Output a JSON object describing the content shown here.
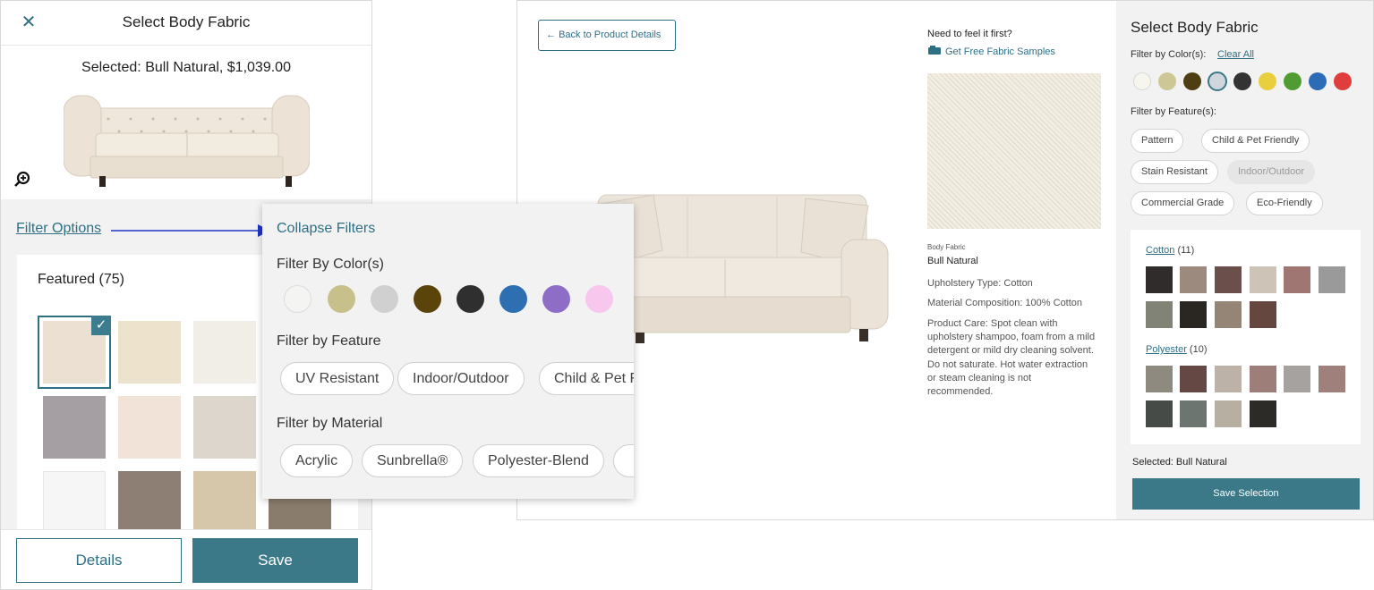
{
  "mobile": {
    "title": "Select Body Fabric",
    "selected_text": "Selected: Bull Natural, $1,039.00",
    "filter_options_link": "Filter Options",
    "featured_heading": "Featured (75)",
    "details_button": "Details",
    "save_button": "Save",
    "swatch_colors": [
      "#ece0d3",
      "#ede2cc",
      "#f1eee8",
      "#a59ea2",
      "#f1e3d7",
      "#ddd6cc",
      "#f6f6f6",
      "#8d7f74",
      "#d6c6aa",
      "#8a7c6d"
    ]
  },
  "filters_popup": {
    "collapse_link": "Collapse Filters",
    "color_heading": "Filter By Color(s)",
    "colors": [
      "#f4f4f2",
      "#c8c08a",
      "#d0d0d0",
      "#5b4409",
      "#2f2f2f",
      "#2e6fb2",
      "#8e6dc7",
      "#f7c7ee"
    ],
    "feature_heading": "Filter by Feature",
    "features": [
      "UV Resistant",
      "Indoor/Outdoor",
      "Child & Pet Friendly"
    ],
    "material_heading": "Filter by Material",
    "materials": [
      "Acrylic",
      "Sunbrella®",
      "Polyester-Blend"
    ]
  },
  "desktop": {
    "back_button": "Back to Product Details",
    "need_feel": "Need to feel it first?",
    "samples_link": "Get Free Fabric Samples",
    "body_fabric_label": "Body Fabric",
    "fabric_name": "Bull Natural",
    "upholstery": "Upholstery Type: Cotton",
    "composition": "Material Composition: 100% Cotton",
    "care": "Product Care: Spot clean with upholstery shampoo, foam from a mild detergent or mild dry cleaning solvent. Do not saturate. Hot water extraction or steam cleaning is not recommended."
  },
  "right_panel": {
    "title": "Select Body Fabric",
    "filter_color_label": "Filter by Color(s):",
    "clear_all": "Clear All",
    "colors": [
      "#f7f6ee",
      "#cdc796",
      "#4f3d14",
      "#cfd6dc",
      "#333333",
      "#e9cf3d",
      "#4f9c33",
      "#2c6bb6",
      "#e03d3d"
    ],
    "filter_feature_label": "Filter by Feature(s):",
    "features": [
      "Pattern",
      "Child & Pet Friendly",
      "Stain Resistant",
      "Indoor/Outdoor",
      "Commercial Grade",
      "Eco-Friendly"
    ],
    "groups": [
      {
        "name": "Cotton",
        "count": "(11)",
        "swatches": [
          "#302c2b",
          "#9c8a7e",
          "#6b4f4b",
          "#cdc3b7",
          "#a07673",
          "#9a9a9a",
          "#818377",
          "#2a2622",
          "#958576",
          "#66473f"
        ]
      },
      {
        "name": "Polyester",
        "count": "(10)",
        "swatches": [
          "#8f8a80",
          "#654744",
          "#bdb2a8",
          "#9e7e78",
          "#a5a2a0",
          "#9f807b",
          "#474b48",
          "#6d7570",
          "#b7afa2",
          "#2c2b28"
        ]
      }
    ],
    "selected_label": "Selected: Bull Natural",
    "save_selection": "Save Selection"
  }
}
